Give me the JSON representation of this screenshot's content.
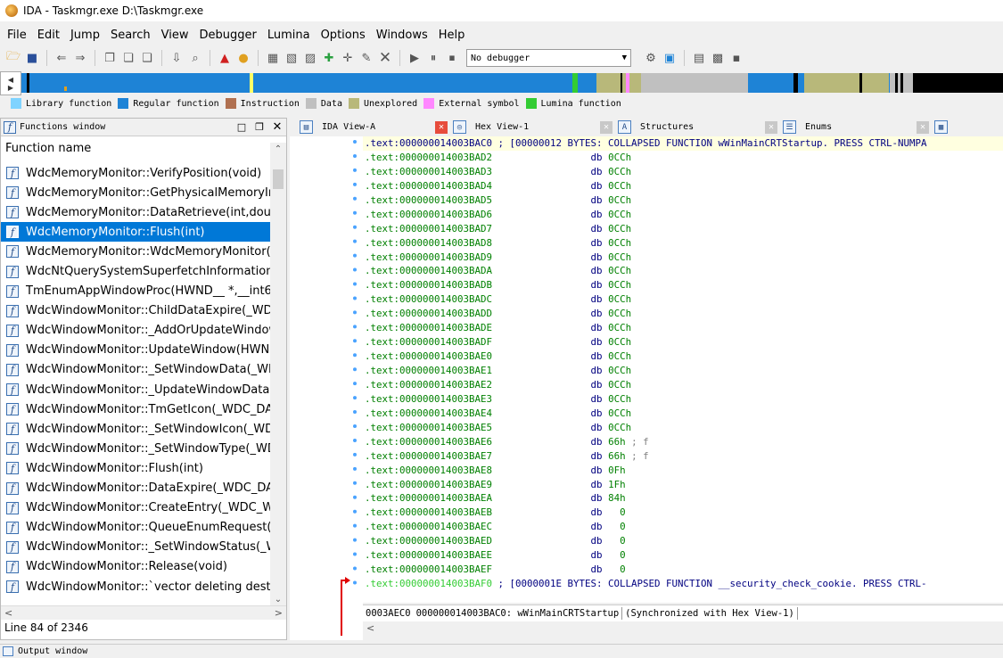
{
  "window": {
    "title": "IDA - Taskmgr.exe D:\\Taskmgr.exe"
  },
  "menu": [
    "File",
    "Edit",
    "Jump",
    "Search",
    "View",
    "Debugger",
    "Lumina",
    "Options",
    "Windows",
    "Help"
  ],
  "toolbar": {
    "debugger_select": "No debugger"
  },
  "legend": [
    {
      "label": "Library function",
      "color": "#7fd3ff"
    },
    {
      "label": "Regular function",
      "color": "#1e83d6"
    },
    {
      "label": "Instruction",
      "color": "#b07050"
    },
    {
      "label": "Data",
      "color": "#c0c0c0"
    },
    {
      "label": "Unexplored",
      "color": "#b8b87a"
    },
    {
      "label": "External symbol",
      "color": "#ff88ff"
    },
    {
      "label": "Lumina function",
      "color": "#33cc33"
    }
  ],
  "functions_panel": {
    "title": "Functions window",
    "column_header": "Function name",
    "status": "Line 84 of 2346",
    "items": [
      "WdcMemoryMonitor::VerifyPosition(void)",
      "WdcMemoryMonitor::GetPhysicalMemoryInfo",
      "WdcMemoryMonitor::DataRetrieve(int,double",
      "WdcMemoryMonitor::Flush(int)",
      "WdcMemoryMonitor::WdcMemoryMonitor(T",
      "WdcNtQuerySystemSuperfetchInformation(_S",
      "TmEnumAppWindowProc(HWND__ *,__int64)",
      "WdcWindowMonitor::ChildDataExpire(_WDC_",
      "WdcWindowMonitor::_AddOrUpdateWindow",
      "WdcWindowMonitor::UpdateWindow(HWND",
      "WdcWindowMonitor::_SetWindowData(_WDC",
      "WdcWindowMonitor::_UpdateWindowData(_\\",
      "WdcWindowMonitor::TmGetIcon(_WDC_DAT/",
      "WdcWindowMonitor::_SetWindowIcon(_WDC",
      "WdcWindowMonitor::_SetWindowType(_WDC",
      "WdcWindowMonitor::Flush(int)",
      "WdcWindowMonitor::DataExpire(_WDC_DAT/",
      "WdcWindowMonitor::CreateEntry(_WDC_WIN",
      "WdcWindowMonitor::QueueEnumRequest(vo",
      "WdcWindowMonitor::_SetWindowStatus(_WD",
      "WdcWindowMonitor::Release(void)",
      "WdcWindowMonitor::`vector deleting destru"
    ],
    "selected_index": 3
  },
  "tabs": [
    {
      "label": "IDA View-A",
      "icon": "IDA",
      "close_color": "#e74c3c"
    },
    {
      "label": "Hex View-1",
      "icon": "hex",
      "close_color": "#c8c8c8"
    },
    {
      "label": "Structures",
      "icon": "A",
      "close_color": "#c8c8c8"
    },
    {
      "label": "Enums",
      "icon": "enum",
      "close_color": "#c8c8c8"
    }
  ],
  "code": {
    "first": {
      "addr": ".text:000000014003BAC0",
      "rest": " ; [00000012 BYTES: COLLAPSED FUNCTION wWinMainCRTStartup. PRESS CTRL-NUMPA"
    },
    "lines": [
      {
        "addr": ".text:000000014003BAD2",
        "op": "db",
        "val": "0CCh",
        "cmt": ""
      },
      {
        "addr": ".text:000000014003BAD3",
        "op": "db",
        "val": "0CCh",
        "cmt": ""
      },
      {
        "addr": ".text:000000014003BAD4",
        "op": "db",
        "val": "0CCh",
        "cmt": ""
      },
      {
        "addr": ".text:000000014003BAD5",
        "op": "db",
        "val": "0CCh",
        "cmt": ""
      },
      {
        "addr": ".text:000000014003BAD6",
        "op": "db",
        "val": "0CCh",
        "cmt": ""
      },
      {
        "addr": ".text:000000014003BAD7",
        "op": "db",
        "val": "0CCh",
        "cmt": ""
      },
      {
        "addr": ".text:000000014003BAD8",
        "op": "db",
        "val": "0CCh",
        "cmt": ""
      },
      {
        "addr": ".text:000000014003BAD9",
        "op": "db",
        "val": "0CCh",
        "cmt": ""
      },
      {
        "addr": ".text:000000014003BADA",
        "op": "db",
        "val": "0CCh",
        "cmt": ""
      },
      {
        "addr": ".text:000000014003BADB",
        "op": "db",
        "val": "0CCh",
        "cmt": ""
      },
      {
        "addr": ".text:000000014003BADC",
        "op": "db",
        "val": "0CCh",
        "cmt": ""
      },
      {
        "addr": ".text:000000014003BADD",
        "op": "db",
        "val": "0CCh",
        "cmt": ""
      },
      {
        "addr": ".text:000000014003BADE",
        "op": "db",
        "val": "0CCh",
        "cmt": ""
      },
      {
        "addr": ".text:000000014003BADF",
        "op": "db",
        "val": "0CCh",
        "cmt": ""
      },
      {
        "addr": ".text:000000014003BAE0",
        "op": "db",
        "val": "0CCh",
        "cmt": ""
      },
      {
        "addr": ".text:000000014003BAE1",
        "op": "db",
        "val": "0CCh",
        "cmt": ""
      },
      {
        "addr": ".text:000000014003BAE2",
        "op": "db",
        "val": "0CCh",
        "cmt": ""
      },
      {
        "addr": ".text:000000014003BAE3",
        "op": "db",
        "val": "0CCh",
        "cmt": ""
      },
      {
        "addr": ".text:000000014003BAE4",
        "op": "db",
        "val": "0CCh",
        "cmt": ""
      },
      {
        "addr": ".text:000000014003BAE5",
        "op": "db",
        "val": "0CCh",
        "cmt": ""
      },
      {
        "addr": ".text:000000014003BAE6",
        "op": "db",
        "val": "66h",
        "cmt": " ; f"
      },
      {
        "addr": ".text:000000014003BAE7",
        "op": "db",
        "val": "66h",
        "cmt": " ; f"
      },
      {
        "addr": ".text:000000014003BAE8",
        "op": "db",
        "val": "0Fh",
        "cmt": ""
      },
      {
        "addr": ".text:000000014003BAE9",
        "op": "db",
        "val": "1Fh",
        "cmt": ""
      },
      {
        "addr": ".text:000000014003BAEA",
        "op": "db",
        "val": "84h",
        "cmt": ""
      },
      {
        "addr": ".text:000000014003BAEB",
        "op": "db",
        "val": "  0",
        "cmt": ""
      },
      {
        "addr": ".text:000000014003BAEC",
        "op": "db",
        "val": "  0",
        "cmt": ""
      },
      {
        "addr": ".text:000000014003BAED",
        "op": "db",
        "val": "  0",
        "cmt": ""
      },
      {
        "addr": ".text:000000014003BAEE",
        "op": "db",
        "val": "  0",
        "cmt": ""
      },
      {
        "addr": ".text:000000014003BAEF",
        "op": "db",
        "val": "  0",
        "cmt": ""
      }
    ],
    "last": {
      "addr": ".text:000000014003BAF0",
      "rest": " ; [0000001E BYTES: COLLAPSED FUNCTION __security_check_cookie. PRESS CTRL-"
    }
  },
  "code_status": {
    "offset": "0003AEC0",
    "location": "000000014003BAC0: wWinMainCRTStartup",
    "sync": "(Synchronized with Hex View-1)"
  },
  "output_window": {
    "title": "Output window"
  }
}
